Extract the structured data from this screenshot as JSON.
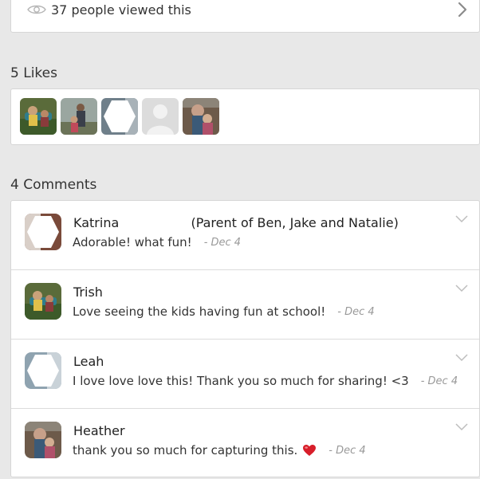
{
  "views": {
    "text": "37 people viewed this"
  },
  "likes": {
    "title": "5 Likes",
    "avatars": [
      {
        "icon": "user-photo-avatar"
      },
      {
        "icon": "user-photo-avatar"
      },
      {
        "icon": "user-placeholder-avatar"
      },
      {
        "icon": "default-user-avatar"
      },
      {
        "icon": "user-photo-avatar"
      }
    ]
  },
  "comments": {
    "title": "4 Comments",
    "items": [
      {
        "name": "Katrina",
        "parent": "(Parent of Ben, Jake and Natalie)",
        "text": "Adorable! what fun!",
        "date": "- Dec 4"
      },
      {
        "name": "Trish",
        "parent": "",
        "text": "Love seeing the kids having fun at school!",
        "date": "- Dec 4"
      },
      {
        "name": "Leah",
        "parent": "",
        "text": "I love love love this! Thank you so much for sharing! <3",
        "date": "- Dec 4"
      },
      {
        "name": "Heather",
        "parent": "",
        "text": "thank you so much for capturing this.",
        "date": "- Dec 4",
        "emoji": "heart-emoji"
      }
    ]
  },
  "colors": {
    "background": "#e8e8e8",
    "card": "#ffffff",
    "date": "#999999",
    "heart": "#d81e2a"
  }
}
